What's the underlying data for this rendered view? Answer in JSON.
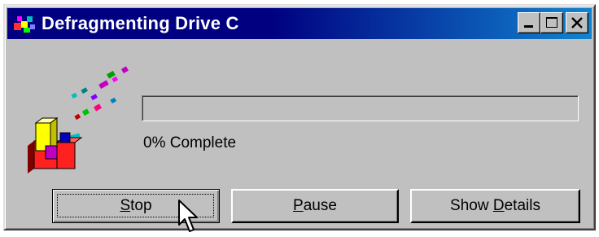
{
  "window": {
    "title": "Defragmenting Drive C",
    "controls": {
      "minimize_icon": "minimize-icon",
      "maximize_icon": "maximize-icon",
      "close_icon": "close-icon"
    },
    "title_gradient": [
      "#000080",
      "#1084d0"
    ],
    "face_color": "#c0c0c0"
  },
  "progress": {
    "value": 0,
    "status_text": "0% Complete"
  },
  "buttons": {
    "stop": {
      "pre": "",
      "mnemonic": "S",
      "post": "top"
    },
    "pause": {
      "pre": "",
      "mnemonic": "P",
      "post": "ause"
    },
    "details": {
      "pre": "Show ",
      "mnemonic": "D",
      "post": "etails"
    }
  },
  "icons": {
    "app_icon": "defrag-icon",
    "illustration": "defrag-blocks-icon",
    "pointer": "mouse-pointer-icon"
  }
}
